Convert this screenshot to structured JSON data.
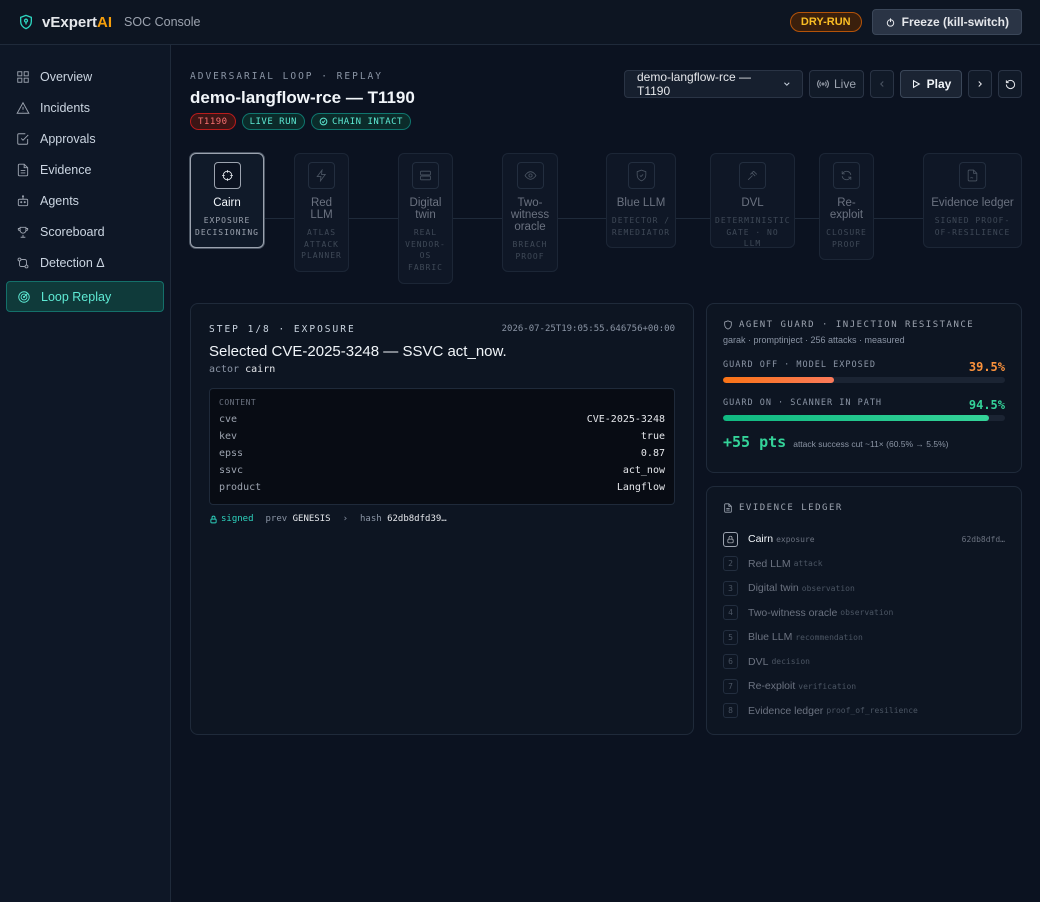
{
  "app": {
    "brand_prefix": "vExpert",
    "brand_suffix": "AI",
    "subtitle": "SOC Console"
  },
  "topbar": {
    "dryrun_label": "DRY-RUN",
    "freeze_label": "Freeze (kill-switch)"
  },
  "sidebar": {
    "items": [
      {
        "label": "Overview",
        "icon": "grid-icon"
      },
      {
        "label": "Incidents",
        "icon": "alert-triangle-icon"
      },
      {
        "label": "Approvals",
        "icon": "check-square-icon"
      },
      {
        "label": "Evidence",
        "icon": "file-text-icon"
      },
      {
        "label": "Agents",
        "icon": "bot-icon"
      },
      {
        "label": "Scoreboard",
        "icon": "trophy-icon"
      },
      {
        "label": "Detection Δ",
        "icon": "git-compare-icon"
      },
      {
        "label": "Loop Replay",
        "icon": "radar-icon",
        "active": true
      }
    ]
  },
  "header": {
    "kicker": "ADVERSARIAL LOOP · REPLAY",
    "title": "demo-langflow-rce — T1190",
    "badges": {
      "technique": "T1190",
      "mode": "LIVE RUN",
      "chain": "CHAIN INTACT"
    }
  },
  "controls": {
    "scenario_selected": "demo-langflow-rce — T1190",
    "live_label": "Live",
    "play_label": "Play"
  },
  "pipeline": {
    "stages": [
      {
        "name": "Cairn",
        "sub": "EXPOSURE DECISIONING",
        "icon": "crosshair-icon"
      },
      {
        "name": "Red LLM",
        "sub": "ATLAS ATTACK PLANNER",
        "icon": "zap-icon"
      },
      {
        "name": "Digital twin",
        "sub": "REAL VENDOR-OS FABRIC",
        "icon": "server-icon"
      },
      {
        "name": "Two-witness oracle",
        "sub": "BREACH PROOF",
        "icon": "eye-icon"
      },
      {
        "name": "Blue LLM",
        "sub": "DETECTOR / REMEDIATOR",
        "icon": "shield-icon"
      },
      {
        "name": "DVL",
        "sub": "DETERMINISTIC GATE · NO LLM",
        "icon": "gavel-icon"
      },
      {
        "name": "Re-exploit",
        "sub": "CLOSURE PROOF",
        "icon": "refresh-icon"
      },
      {
        "name": "Evidence ledger",
        "sub": "SIGNED PROOF-OF-RESILIENCE",
        "icon": "file-signature-icon"
      }
    ]
  },
  "step": {
    "header": "STEP 1/8 · EXPOSURE",
    "timestamp": "2026-07-25T19:05:55.646756+00:00",
    "title": "Selected CVE-2025-3248 — SSVC act_now.",
    "actor_label": "actor",
    "actor": "cairn",
    "content_label": "CONTENT",
    "content": [
      {
        "k": "cve",
        "v": "CVE-2025-3248"
      },
      {
        "k": "kev",
        "v": "true"
      },
      {
        "k": "epss",
        "v": "0.87"
      },
      {
        "k": "ssvc",
        "v": "act_now"
      },
      {
        "k": "product",
        "v": "Langflow"
      }
    ],
    "signed_label": "signed",
    "prev_label": "prev",
    "prev": "GENESIS",
    "hash_label": "hash",
    "hash": "62db8dfd39…"
  },
  "guard": {
    "title": "AGENT GUARD · INJECTION RESISTANCE",
    "subtitle": "garak · promptinject · 256 attacks · measured",
    "off_label": "GUARD OFF · MODEL EXPOSED",
    "off_pct": "39.5%",
    "off_value": 39.5,
    "on_label": "GUARD ON · SCANNER IN PATH",
    "on_pct": "94.5%",
    "on_value": 94.5,
    "pts": "+55 pts",
    "pts_note": "attack success cut ~11× (60.5% → 5.5%)"
  },
  "ledger": {
    "title": "EVIDENCE LEDGER",
    "items": [
      {
        "num": "1",
        "label": "Cairn",
        "kind": "exposure",
        "hash": "62db8dfd…",
        "active": true
      },
      {
        "num": "2",
        "label": "Red LLM",
        "kind": "attack"
      },
      {
        "num": "3",
        "label": "Digital twin",
        "kind": "observation"
      },
      {
        "num": "4",
        "label": "Two-witness oracle",
        "kind": "observation"
      },
      {
        "num": "5",
        "label": "Blue LLM",
        "kind": "recommendation"
      },
      {
        "num": "6",
        "label": "DVL",
        "kind": "decision"
      },
      {
        "num": "7",
        "label": "Re-exploit",
        "kind": "verification"
      },
      {
        "num": "8",
        "label": "Evidence ledger",
        "kind": "proof_of_resilience"
      }
    ]
  }
}
